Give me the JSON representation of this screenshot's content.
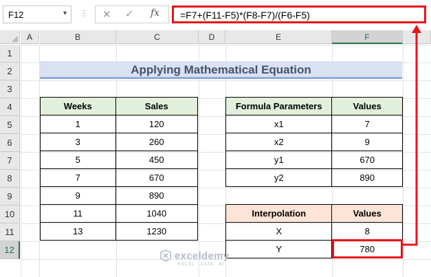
{
  "formula_bar": {
    "name_box": "F12",
    "name_box_arrow": "▾",
    "dots": "⋮",
    "cancel_symbol": "✕",
    "enter_symbol": "✓",
    "fx_label": "fx",
    "formula": "=F7+(F11-F5)*(F8-F7)/(F6-F5)",
    "highlight_color": "#e8141b"
  },
  "columns": [
    "A",
    "B",
    "C",
    "D",
    "E",
    "F"
  ],
  "selected_column": "F",
  "rows": [
    "1",
    "2",
    "3",
    "4",
    "5",
    "6",
    "7",
    "8",
    "9",
    "10",
    "11",
    "12"
  ],
  "selected_row": "12",
  "title": "Applying Mathematical Equation",
  "sales_table": {
    "headers": [
      "Weeks",
      "Sales"
    ],
    "rows": [
      [
        "1",
        "120"
      ],
      [
        "3",
        "260"
      ],
      [
        "5",
        "450"
      ],
      [
        "7",
        "670"
      ],
      [
        "9",
        "890"
      ],
      [
        "11",
        "1040"
      ],
      [
        "13",
        "1230"
      ]
    ]
  },
  "params_table": {
    "headers": [
      "Formula Parameters",
      "Values"
    ],
    "rows": [
      [
        "x1",
        "7"
      ],
      [
        "x2",
        "9"
      ],
      [
        "y1",
        "670"
      ],
      [
        "y2",
        "890"
      ]
    ]
  },
  "interp_table": {
    "headers": [
      "Interpolation",
      "Values"
    ],
    "rows": [
      [
        "X",
        "8"
      ],
      [
        "Y",
        "780"
      ]
    ]
  },
  "watermark": {
    "name": "exceldemy",
    "tagline": "EXCEL · DATA · BI"
  }
}
